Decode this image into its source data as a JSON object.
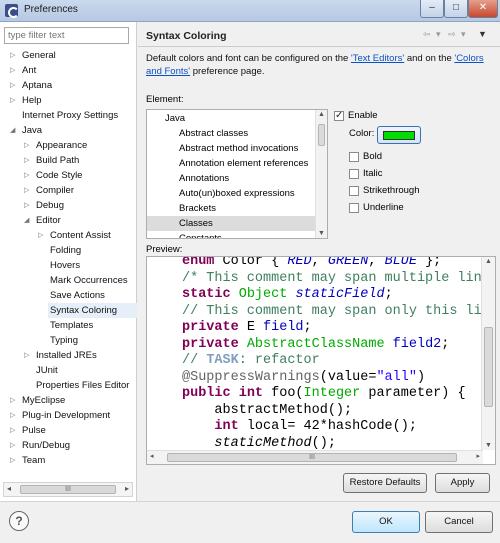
{
  "window": {
    "title": "Preferences",
    "controls": {
      "minimize": "–",
      "maximize": "□",
      "close": "✕"
    }
  },
  "sidebar": {
    "filter_placeholder": "type filter text",
    "items": [
      {
        "label": "General",
        "expander": "▷"
      },
      {
        "label": "Ant",
        "expander": "▷"
      },
      {
        "label": "Aptana",
        "expander": "▷"
      },
      {
        "label": "Help",
        "expander": "▷"
      },
      {
        "label": "Internet Proxy Settings",
        "expander": ""
      },
      {
        "label": "Java",
        "expander": "◢"
      },
      {
        "label": "Appearance",
        "expander": "▷"
      },
      {
        "label": "Build Path",
        "expander": "▷"
      },
      {
        "label": "Code Style",
        "expander": "▷"
      },
      {
        "label": "Compiler",
        "expander": "▷"
      },
      {
        "label": "Debug",
        "expander": "▷"
      },
      {
        "label": "Editor",
        "expander": "◢"
      },
      {
        "label": "Content Assist",
        "expander": "▷"
      },
      {
        "label": "Folding",
        "expander": ""
      },
      {
        "label": "Hovers",
        "expander": ""
      },
      {
        "label": "Mark Occurrences",
        "expander": ""
      },
      {
        "label": "Save Actions",
        "expander": ""
      },
      {
        "label": "Syntax Coloring",
        "expander": ""
      },
      {
        "label": "Templates",
        "expander": ""
      },
      {
        "label": "Typing",
        "expander": ""
      },
      {
        "label": "Installed JREs",
        "expander": "▷"
      },
      {
        "label": "JUnit",
        "expander": ""
      },
      {
        "label": "Properties Files Editor",
        "expander": ""
      },
      {
        "label": "MyEclipse",
        "expander": "▷"
      },
      {
        "label": "Plug-in Development",
        "expander": "▷"
      },
      {
        "label": "Pulse",
        "expander": "▷"
      },
      {
        "label": "Run/Debug",
        "expander": "▷"
      },
      {
        "label": "Team",
        "expander": "▷"
      }
    ],
    "scroll_thumb_grip": "III"
  },
  "page": {
    "title": "Syntax Coloring",
    "nav": {
      "back": "⇦",
      "back_menu": "▾",
      "forward": "⇨",
      "forward_menu": "▾",
      "view_menu": "▼"
    },
    "description": {
      "part1": "Default colors and font can be configured on the ",
      "link1": "'Text Editors'",
      "part2": " and on the ",
      "link2": "'Colors and Fonts'",
      "part3": " preference page."
    },
    "element_label": "Element:",
    "element_list": [
      "Java",
      "Abstract classes",
      "Abstract method invocations",
      "Annotation element references",
      "Annotations",
      "Auto(un)boxed expressions",
      "Brackets",
      "Classes",
      "Constants"
    ],
    "enable_label": "Enable",
    "color_label": "Color:",
    "color_value": "#00dd00",
    "style_options": [
      "Bold",
      "Italic",
      "Strikethrough",
      "Underline"
    ],
    "preview_label": "Preview:",
    "code_lines": [
      [
        [
          "kw",
          "enum"
        ],
        [
          "",
          " Color { "
        ],
        [
          "fld-s",
          "RED"
        ],
        [
          "",
          ", "
        ],
        [
          "fld-s",
          "GREEN"
        ],
        [
          "",
          ", "
        ],
        [
          "fld-s",
          "BLUE"
        ],
        [
          "",
          " };"
        ]
      ],
      [
        [
          "cm",
          "/* This comment may span multiple lin"
        ]
      ],
      [
        [
          "kw",
          "static"
        ],
        [
          "",
          " "
        ],
        [
          "cls",
          "Object"
        ],
        [
          "",
          " "
        ],
        [
          "fld-s",
          "staticField"
        ],
        [
          "",
          ";"
        ]
      ],
      [
        [
          "cm",
          "// This comment may span only this li"
        ]
      ],
      [
        [
          "kw",
          "private"
        ],
        [
          "",
          " E "
        ],
        [
          "fld",
          "field"
        ],
        [
          "",
          ";"
        ]
      ],
      [
        [
          "kw",
          "private"
        ],
        [
          "",
          " "
        ],
        [
          "cls",
          "AbstractClassName"
        ],
        [
          "",
          " "
        ],
        [
          "fld",
          "field2"
        ],
        [
          "",
          ";"
        ]
      ],
      [
        [
          "cm",
          "// "
        ],
        [
          "kw-cm",
          "TASK"
        ],
        [
          "cm",
          ": refactor"
        ]
      ],
      [
        [
          "ann",
          "@SuppressWarnings"
        ],
        [
          "",
          "(value="
        ],
        [
          "str",
          "\"all\""
        ],
        [
          "",
          ")"
        ]
      ],
      [
        [
          "kw",
          "public"
        ],
        [
          "",
          " "
        ],
        [
          "kw",
          "int"
        ],
        [
          "",
          " foo("
        ],
        [
          "cls",
          "Integer"
        ],
        [
          "",
          " parameter) {"
        ]
      ],
      [
        [
          "",
          "    abstractMethod();"
        ]
      ],
      [
        [
          "",
          "    "
        ],
        [
          "kw",
          "int"
        ],
        [
          "",
          " local= 42*hashCode();"
        ]
      ],
      [
        [
          "",
          "    "
        ],
        [
          "mth-s",
          "staticMethod"
        ],
        [
          "",
          "();"
        ]
      ]
    ],
    "restore_defaults": "Restore Defaults",
    "apply": "Apply"
  },
  "footer": {
    "help_icon": "?",
    "ok": "OK",
    "cancel": "Cancel"
  }
}
